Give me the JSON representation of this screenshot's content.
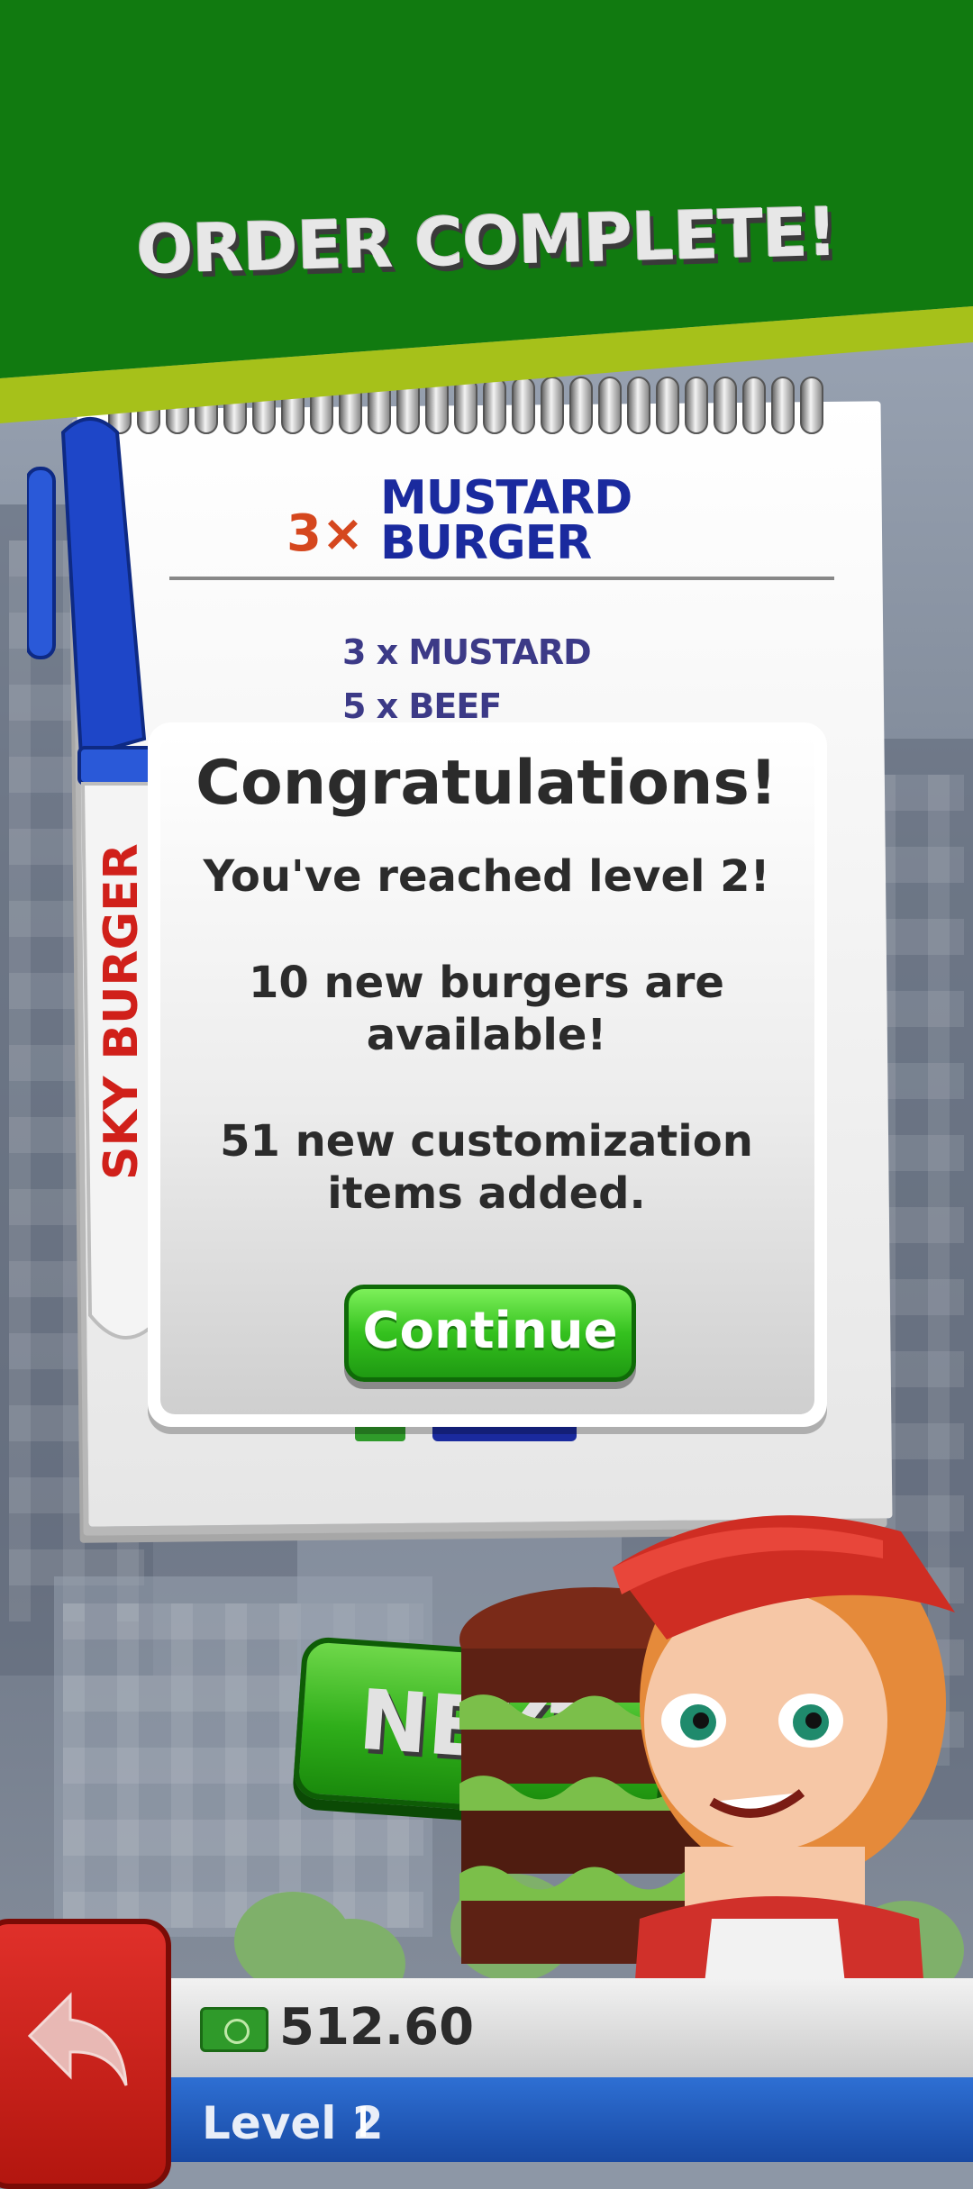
{
  "header": {
    "title": "ORDER COMPLETE!"
  },
  "order": {
    "quantity": "3×",
    "burger_name_line1": "MUSTARD",
    "burger_name_line2": "BURGER",
    "ingredients": [
      "3 x MUSTARD",
      "5 x BEEF"
    ],
    "pen_brand": "SKY BURGER"
  },
  "modal": {
    "title": "Congratulations!",
    "line_level": "You've reached level 2!",
    "line_burgers_1": "10 new burgers are",
    "line_burgers_2": "available!",
    "line_items_1": "51 new customization",
    "line_items_2": "items added.",
    "continue_label": "Continue"
  },
  "next_button": {
    "label": "NEXT"
  },
  "status": {
    "money": "512.60",
    "level": "Level 2"
  },
  "colors": {
    "header_green": "#117a10",
    "header_stripe": "#a6c11a",
    "ink_blue": "#1a2a9e",
    "qty_orange": "#d5471e",
    "continue_green": "#34c11e",
    "level_blue": "#2e6fd3",
    "back_red": "#d0201a"
  },
  "icons": [
    "back-arrow-icon",
    "money-icon"
  ]
}
